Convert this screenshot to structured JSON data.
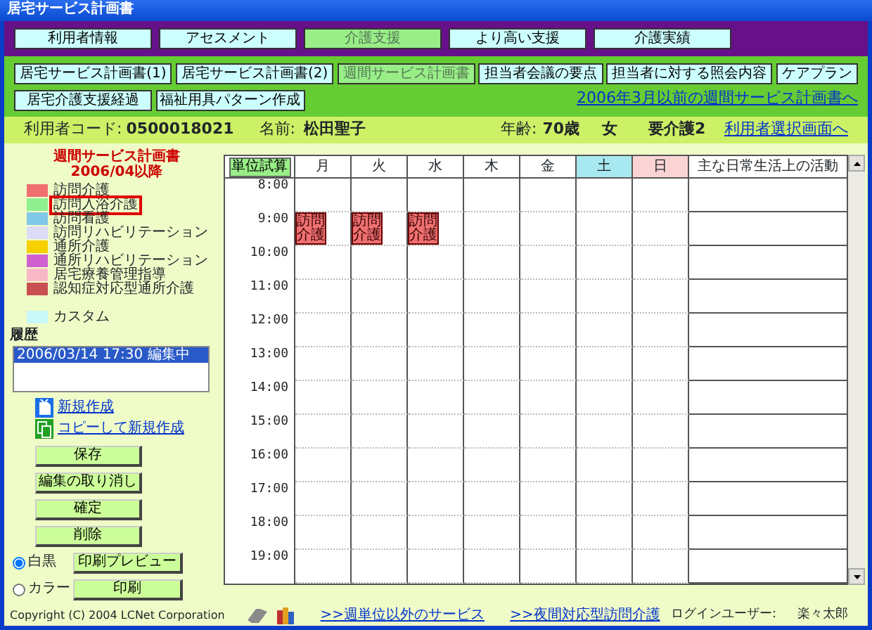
{
  "window": {
    "title": "居宅サービス計画書"
  },
  "main_tabs": [
    {
      "label": "利用者情報",
      "selected": false
    },
    {
      "label": "アセスメント",
      "selected": false
    },
    {
      "label": "介護支援",
      "selected": true
    },
    {
      "label": "より高い支援",
      "selected": false
    },
    {
      "label": "介護実績",
      "selected": false
    }
  ],
  "sub_tabs": [
    [
      {
        "label": "居宅サービス計画書(1)",
        "selected": false
      },
      {
        "label": "居宅サービス計画書(2)",
        "selected": false
      },
      {
        "label": "週間サービス計画書",
        "selected": true
      },
      {
        "label": "担当者会議の要点",
        "selected": false
      },
      {
        "label": "担当者に対する照会内容",
        "selected": false
      },
      {
        "label": "ケアプラン",
        "selected": false
      }
    ],
    [
      {
        "label": "居宅介護支援経過",
        "selected": false
      },
      {
        "label": "福祉用具パターン作成",
        "selected": false
      }
    ]
  ],
  "old_plan_link": "2006年3月以前の週間サービス計画書へ",
  "info": {
    "user_code_label": "利用者コード:",
    "user_code": "0500018021",
    "name_label": "名前:",
    "name": "松田聖子",
    "age_label": "年齢:",
    "age": "70歳",
    "sex": "女",
    "care_level": "要介護2",
    "select_link": "利用者選択画面へ"
  },
  "plan_title": [
    "週間サービス計画書",
    "2006/04以降"
  ],
  "legend": [
    {
      "label": "訪問介護",
      "color": "#f07070",
      "highlighted": false
    },
    {
      "label": "訪問入浴介護",
      "color": "#90f090",
      "highlighted": true
    },
    {
      "label": "訪問看護",
      "color": "#80c8e8",
      "highlighted": false
    },
    {
      "label": "訪問リハビリテーション",
      "color": "#dcdcf8",
      "highlighted": false
    },
    {
      "label": "通所介護",
      "color": "#f8d000",
      "highlighted": false
    },
    {
      "label": "通所リハビリテーション",
      "color": "#d060d0",
      "highlighted": false
    },
    {
      "label": "居宅療養管理指導",
      "color": "#f8b8c8",
      "highlighted": false
    },
    {
      "label": "認知症対応型通所介護",
      "color": "#c85050",
      "highlighted": false
    }
  ],
  "custom": {
    "label": "カスタム",
    "color": "#c8f8f8"
  },
  "history": {
    "label": "履歴",
    "items": [
      {
        "text": "2006/03/14 17:30 編集中",
        "selected": true
      }
    ]
  },
  "actions": [
    {
      "kind": "new",
      "label": "新規作成"
    },
    {
      "kind": "copy",
      "label": "コピーして新規作成"
    }
  ],
  "buttons": [
    "保存",
    "編集の取り消し",
    "確定",
    "削除"
  ],
  "print_rows": [
    {
      "mode": "白黒",
      "selected": true,
      "button": "印刷プレビュー"
    },
    {
      "mode": "カラー",
      "selected": false,
      "button": "印刷"
    }
  ],
  "schedule": {
    "unit_button": "単位試算",
    "days": [
      {
        "label": "月",
        "kind": "weekday"
      },
      {
        "label": "火",
        "kind": "weekday"
      },
      {
        "label": "水",
        "kind": "weekday"
      },
      {
        "label": "木",
        "kind": "weekday"
      },
      {
        "label": "金",
        "kind": "weekday"
      },
      {
        "label": "土",
        "kind": "saturday"
      },
      {
        "label": "日",
        "kind": "sunday"
      }
    ],
    "activity_header": "主な日常生活上の活動",
    "hours": [
      {
        "time": "8:00"
      },
      {
        "time": "9:00",
        "events": [
          {
            "label": "訪問介護",
            "color": "#f07070"
          },
          {
            "label": "訪問介護",
            "color": "#f07070"
          },
          {
            "label": "訪問介護",
            "color": "#f07070"
          }
        ]
      },
      {
        "time": "10:00"
      },
      {
        "time": "11:00"
      },
      {
        "time": "12:00"
      },
      {
        "time": "13:00"
      },
      {
        "time": "14:00"
      },
      {
        "time": "15:00"
      },
      {
        "time": "16:00"
      },
      {
        "time": "17:00"
      },
      {
        "time": "18:00"
      },
      {
        "time": "19:00"
      }
    ]
  },
  "footer": {
    "copyright": "Copyright (C) 2004 LCNet Corporation",
    "links": [
      ">>週単位以外のサービス",
      ">>夜間対応型訪問介護"
    ],
    "login_label": "ログインユーザー:",
    "login_user": "楽々太郎"
  }
}
